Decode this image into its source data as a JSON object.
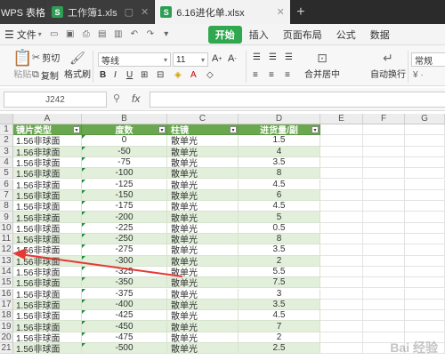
{
  "tabbar": {
    "app_label": "WPS 表格",
    "tabs": [
      {
        "label": "工作簿1.xls",
        "icon": "S",
        "active": false
      },
      {
        "label": "6.16进化单.xlsx",
        "icon": "S",
        "active": true
      }
    ],
    "add_tab": "+"
  },
  "menubar": {
    "file_label": "文件",
    "tabs": [
      "开始",
      "插入",
      "页面布局",
      "公式",
      "数据"
    ],
    "active_tab": "开始"
  },
  "ribbon": {
    "cut": "剪切",
    "copy": "复制",
    "paste": "粘贴",
    "format_painter": "格式刷",
    "font_name": "等线",
    "font_size": "11",
    "merge_center": "合并居中",
    "wrap_text": "自动换行",
    "number_format": "常规"
  },
  "formula_bar": {
    "name_box": "J242",
    "fx": "fx",
    "value": ""
  },
  "grid": {
    "columns": [
      "A",
      "B",
      "C",
      "D",
      "E",
      "F",
      "G"
    ],
    "row_numbers": [
      "1",
      "2",
      "3",
      "4",
      "5",
      "6",
      "7",
      "8",
      "9",
      "10",
      "11",
      "12",
      "13",
      "14",
      "15",
      "16",
      "17",
      "18",
      "19",
      "20",
      "21"
    ],
    "headers": [
      "镜片类型",
      "度数",
      "柱镜",
      "进货量/副"
    ],
    "rows": [
      [
        "1.56非球面",
        "0",
        "散单光",
        "1.5"
      ],
      [
        "1.56非球面",
        "-50",
        "散单光",
        "4"
      ],
      [
        "1.56非球面",
        "-75",
        "散单光",
        "3.5"
      ],
      [
        "1.56非球面",
        "-100",
        "散单光",
        "8"
      ],
      [
        "1.56非球面",
        "-125",
        "散单光",
        "4.5"
      ],
      [
        "1.56非球面",
        "-150",
        "散单光",
        "6"
      ],
      [
        "1.56非球面",
        "-175",
        "散单光",
        "4.5"
      ],
      [
        "1.56非球面",
        "-200",
        "散单光",
        "5"
      ],
      [
        "1.56非球面",
        "-225",
        "散单光",
        "0.5"
      ],
      [
        "1.56非球面",
        "-250",
        "散单光",
        "8"
      ],
      [
        "1.56非球面",
        "-275",
        "散单光",
        "3.5"
      ],
      [
        "1.56非球面",
        "-300",
        "散单光",
        "2"
      ],
      [
        "1.56非球面",
        "-325",
        "散单光",
        "5.5"
      ],
      [
        "1.56非球面",
        "-350",
        "散单光",
        "7.5"
      ],
      [
        "1.56非球面",
        "-375",
        "散单光",
        "3"
      ],
      [
        "1.56非球面",
        "-400",
        "散单光",
        "3.5"
      ],
      [
        "1.56非球面",
        "-425",
        "散单光",
        "4.5"
      ],
      [
        "1.56非球面",
        "-450",
        "散单光",
        "7"
      ],
      [
        "1.56非球面",
        "-475",
        "散单光",
        "2"
      ],
      [
        "1.56非球面",
        "-500",
        "散单光",
        "2.5"
      ]
    ]
  },
  "colors": {
    "header_green": "#6aa84f",
    "band_green": "#e2efda",
    "accent_green": "#2fa84f",
    "arrow_red": "#e53935"
  },
  "watermark": "Bai经验"
}
